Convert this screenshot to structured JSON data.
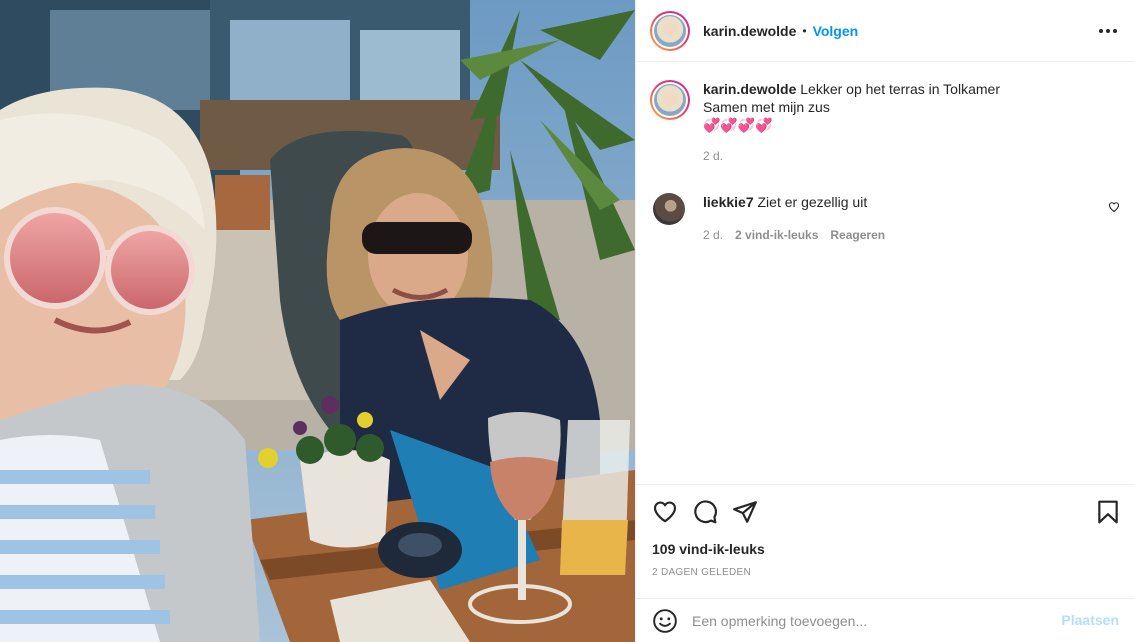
{
  "post": {
    "author": "karin.dewolde",
    "separator": "•",
    "follow_label": "Volgen",
    "more_icon": "more-horizontal-icon"
  },
  "caption": {
    "username": "karin.dewolde",
    "line1": "Lekker op het terras in Tolkamer",
    "line2": "Samen met mijn zus",
    "emojis": "💞💞💞💞",
    "age": "2 d."
  },
  "comments": [
    {
      "username": "liekkie7",
      "text": "Ziet er gezellig uit",
      "age": "2 d.",
      "likes": "2 vind-ik-leuks",
      "reply_label": "Reageren",
      "like_icon": "heart-small-icon"
    }
  ],
  "actions": {
    "like_icon": "heart-icon",
    "comment_icon": "comment-bubble-icon",
    "share_icon": "paper-plane-icon",
    "save_icon": "bookmark-icon",
    "likes_count": "109 vind-ik-leuks",
    "posted_ago": "2 DAGEN GELEDEN"
  },
  "add_comment": {
    "emoji_icon": "smiley-icon",
    "placeholder": "Een opmerking toevoegen...",
    "post_label": "Plaatsen"
  },
  "colors": {
    "accent": "#0095f6",
    "post_disabled": "#b2dffc",
    "secondary_text": "#8e8e8e",
    "border": "#efefef"
  }
}
